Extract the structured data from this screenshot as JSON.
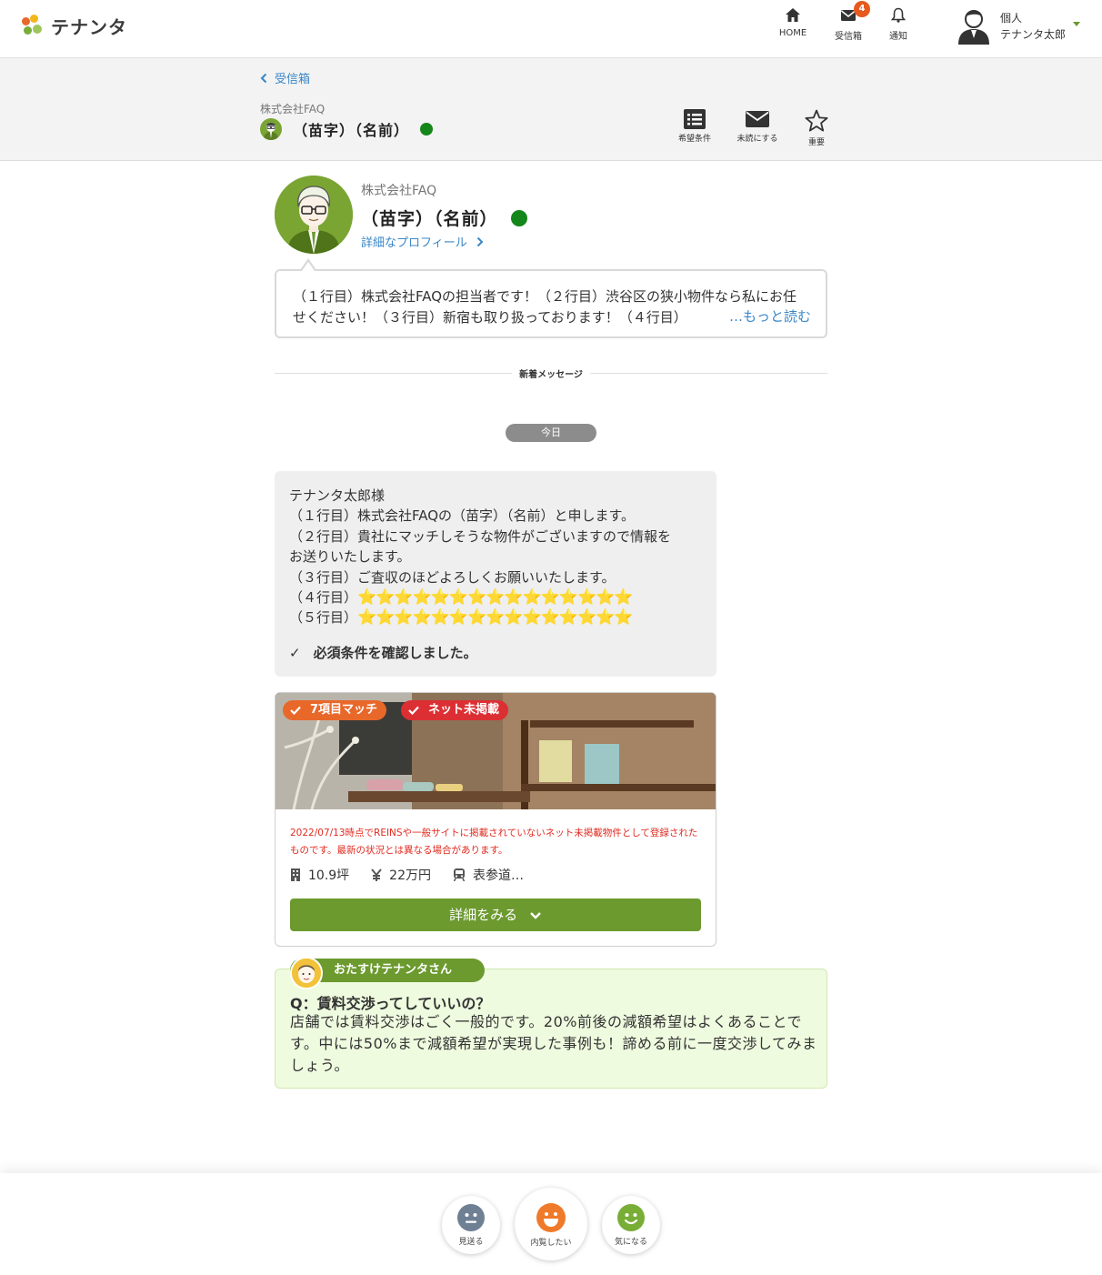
{
  "header": {
    "logo_text": "テナンタ",
    "nav": [
      {
        "label": "HOME",
        "icon": "home-icon"
      },
      {
        "label": "受信箱",
        "icon": "mail-icon",
        "badge": "4"
      },
      {
        "label": "通知",
        "icon": "bell-icon"
      }
    ],
    "user": {
      "type": "個人",
      "name": "テナンタ太郎"
    }
  },
  "subheader": {
    "back_label": "受信箱",
    "company": "株式会社FAQ",
    "person_name": "（苗字）（名前）",
    "actions": [
      {
        "label": "希望条件",
        "icon": "list-icon"
      },
      {
        "label": "未読にする",
        "icon": "envelope-icon"
      },
      {
        "label": "重要",
        "icon": "star-icon"
      }
    ]
  },
  "profile": {
    "company": "株式会社FAQ",
    "name": "（苗字）（名前）",
    "detail_link": "詳細なプロフィール",
    "intro": "（１行目）株式会社FAQの担当者です！（２行目）渋谷区の狭小物件なら私にお任せください！（３行目）新宿も取り扱っております！（４行目）",
    "more_link": "…もっと読む"
  },
  "divider_label": "新着メッセージ",
  "date_label": "今日",
  "message": {
    "lines": [
      "テナンタ太郎様",
      "（１行目）株式会社FAQの（苗字）（名前）と申します。",
      "（２行目）貴社にマッチしそうな物件がございますので情報を",
      "お送りいたします。",
      "（３行目）ご査収のほどよろしくお願いいたします。"
    ],
    "line4_prefix": "（４行目）",
    "line4_stars": "⭐⭐⭐⭐⭐⭐⭐⭐⭐⭐⭐⭐⭐⭐⭐",
    "line5_prefix": "（５行目）",
    "line5_stars": "⭐⭐⭐⭐⭐⭐⭐⭐⭐⭐⭐⭐⭐⭐⭐",
    "confirm_mark": "✓",
    "confirm_text": "必須条件を確認しました。"
  },
  "property": {
    "tags": [
      {
        "label": "7項目マッチ",
        "color": "#e8682a"
      },
      {
        "label": "ネット未掲載",
        "color": "#dc2f33"
      }
    ],
    "note": "2022/07/13時点でREINSや一般サイトに掲載されていないネット未掲載物件として登録されたものです。最新の状況とは異なる場合があります。",
    "area": "10.9坪",
    "rent": "22万円",
    "station": "表参道…",
    "detail_button": "詳細をみる"
  },
  "tip": {
    "title": "おたすけテナンタさん",
    "question": "Q：賃料交渉ってしていいの？",
    "answer": "店舗では賃料交渉はごく一般的です。20%前後の減額希望はよくあることです。中には50%まで減額希望が実現した事例も！諦める前に一度交渉してみましょう。"
  },
  "reactions": [
    {
      "label": "見送る",
      "color": "#6f7f94"
    },
    {
      "label": "内覧したい",
      "color": "#ef7a2a"
    },
    {
      "label": "気になる",
      "color": "#78ad36"
    }
  ],
  "colors": {
    "accent_green": "#6c9a2f",
    "link_blue": "#3a87c8",
    "online_green": "#15861a",
    "badge_orange": "#e65a1e"
  }
}
